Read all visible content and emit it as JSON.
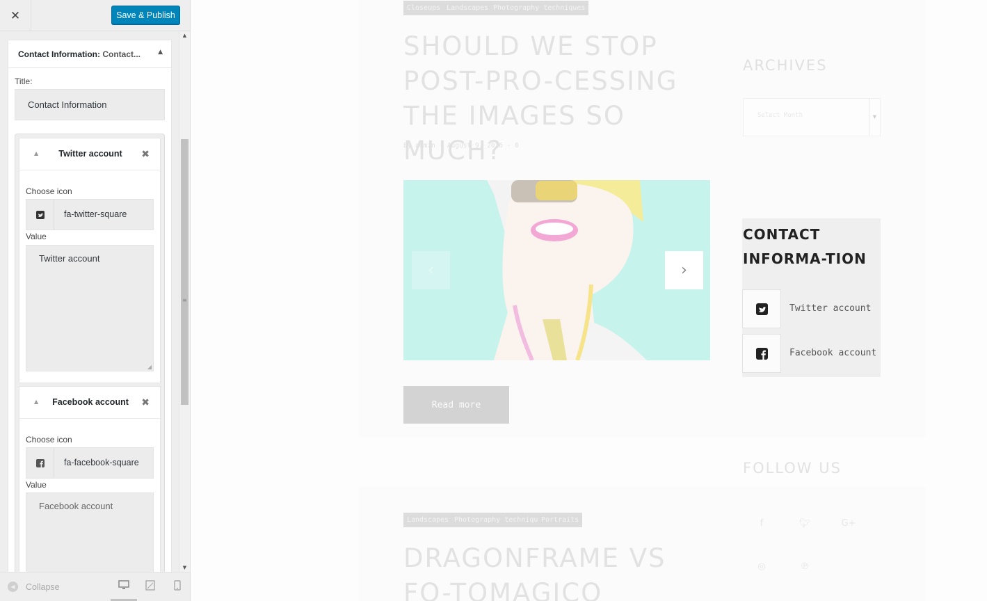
{
  "customizer": {
    "close_icon": "close-icon",
    "publish_label": "Save & Publish",
    "widget": {
      "title_main": "Contact Information:",
      "title_sub": "Contact...",
      "title_field_label": "Title:",
      "title_field_value": "Contact Information",
      "items": [
        {
          "name": "Twitter account",
          "choose_icon_label": "Choose icon",
          "icon_class": "fa-twitter-square",
          "icon": "twitter-square-icon",
          "value_label": "Value",
          "value": "Twitter account"
        },
        {
          "name": "Facebook account",
          "choose_icon_label": "Choose icon",
          "icon_class": "fa-facebook-square",
          "icon": "facebook-square-icon",
          "value_label": "Value",
          "value": "Facebook account"
        }
      ]
    },
    "footer": {
      "collapse_label": "Collapse",
      "devices": [
        "desktop",
        "tablet",
        "mobile"
      ],
      "active_device": "desktop"
    }
  },
  "preview": {
    "post1": {
      "tags": [
        "Closeups",
        "Landscapes",
        "Photography techniques"
      ],
      "title": "Should we stop post-pro-cessing the images so much?",
      "meta": "By admin - August 9, 2016 - 0",
      "read_more": "Read more"
    },
    "archives": {
      "title": "ARCHIVES",
      "select_placeholder": "Select Month"
    },
    "contact": {
      "title": "CONTACT INFORMA-TION",
      "rows": [
        {
          "icon": "twitter-square-icon",
          "label": "Twitter account"
        },
        {
          "icon": "facebook-square-icon",
          "label": "Facebook account"
        }
      ]
    },
    "follow": {
      "title": "FOLLOW US",
      "icons": [
        "facebook-icon",
        "twitter-icon",
        "google-plus-icon",
        "instagram-icon",
        "pinterest-icon"
      ]
    },
    "post2": {
      "tags": [
        "Landscapes",
        "Photography techniques",
        "Portraits"
      ],
      "title": "Dragonframe vs Fo-tomagico"
    }
  },
  "colors": {
    "publish_button": "#0085ba",
    "sidebar_bg": "#eeeeee",
    "faded_text": "#e2e2e2",
    "image_bg": "#c6f3ec"
  }
}
